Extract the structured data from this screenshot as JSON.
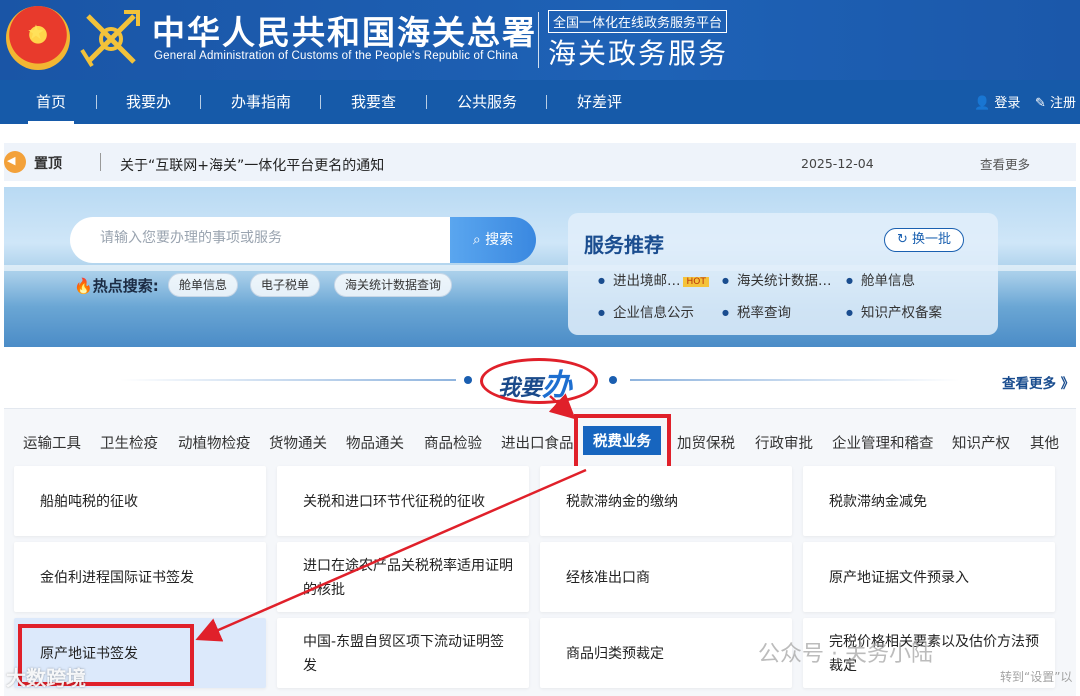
{
  "header": {
    "title_cn": "中华人民共和国海关总署",
    "title_en": "General Administration of Customs of the People's Republic of China",
    "platform_tag": "全国一体化在线政务服务平台",
    "service_title": "海关政务服务"
  },
  "nav": {
    "items": [
      "首页",
      "我要办",
      "办事指南",
      "我要查",
      "公共服务",
      "好差评"
    ],
    "login": "登录",
    "register": "注册"
  },
  "notice": {
    "pin": "置顶",
    "text": "关于“互联网+海关”一体化平台更名的通知",
    "date": "2025-12-04",
    "more": "查看更多"
  },
  "search": {
    "placeholder": "请输入您要办理的事项或服务",
    "button": "搜索",
    "hot_label": "热点搜索:",
    "hot_tags": [
      "舱单信息",
      "电子税单",
      "海关统计数据查询"
    ]
  },
  "recommend": {
    "title": "服务推荐",
    "refresh": "换一批",
    "items": [
      "进出境邮…",
      "海关统计数据…",
      "舱单信息",
      "企业信息公示",
      "税率查询",
      "知识产权备案"
    ],
    "hot_badge": "HOT"
  },
  "section": {
    "title_a": "我要",
    "title_b": "办",
    "more": "查看更多 》"
  },
  "tabs": [
    "运输工具",
    "卫生检疫",
    "动植物检疫",
    "货物通关",
    "物品通关",
    "商品检验",
    "进出口食品",
    "税费业务",
    "加贸保税",
    "行政审批",
    "企业管理和稽查",
    "知识产权",
    "其他"
  ],
  "cards": [
    "船舶吨税的征收",
    "关税和进口环节代征税的征收",
    "税款滞纳金的缴纳",
    "税款滞纳金减免",
    "金伯利进程国际证书签发",
    "进口在途农产品关税税率适用证明的核批",
    "经核准出口商",
    "原产地证据文件预录入",
    "原产地证书签发",
    "中国-东盟自贸区项下流动证明签发",
    "商品归类预裁定",
    "完税价格相关要素以及估价方法预裁定"
  ],
  "watermark": {
    "left": "大数跨境",
    "right": "公众号 · 关务小陆",
    "sub": "转到“设置”以"
  },
  "colors": {
    "header_blue": "#1c5cae",
    "nav_blue": "#165aa9",
    "active_tab": "#1765bf",
    "highlight_red": "#e0202a"
  }
}
